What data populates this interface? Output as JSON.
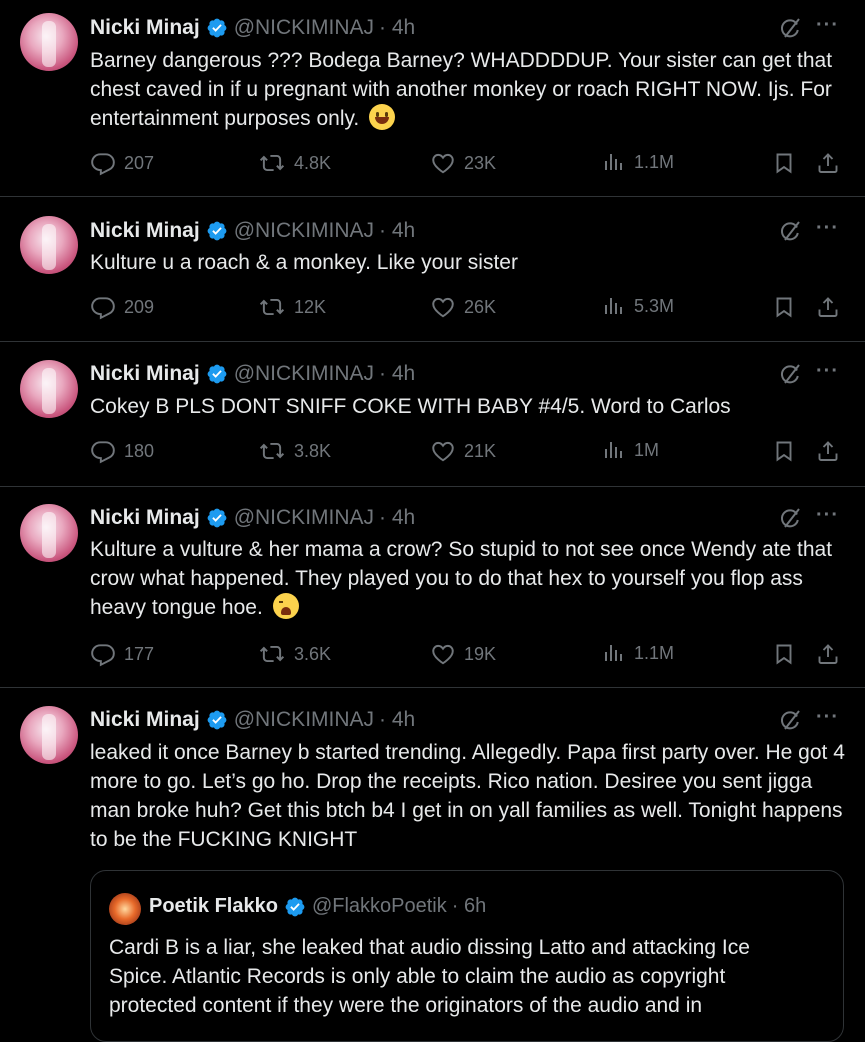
{
  "tweets": [
    {
      "name": "Nicki Minaj",
      "handle": "@NICKIMINAJ",
      "time": "· 4h",
      "text": "Barney dangerous ??? Bodega Barney? WHADDDDUP. Your sister can get that chest caved in if u pregnant with another monkey or roach RIGHT NOW. Ijs. For entertainment purposes only.",
      "emoji": "smile-emoji",
      "replies": "207",
      "reposts": "4.8K",
      "likes": "23K",
      "views": "1.1M"
    },
    {
      "name": "Nicki Minaj",
      "handle": "@NICKIMINAJ",
      "time": "· 4h",
      "text": "Kulture u a roach & a monkey. Like your sister",
      "replies": "209",
      "reposts": "12K",
      "likes": "26K",
      "views": "5.3M"
    },
    {
      "name": "Nicki Minaj",
      "handle": "@NICKIMINAJ",
      "time": "· 4h",
      "text": "Cokey B PLS DONT SNIFF COKE WITH BABY #4/5. Word to Carlos",
      "replies": "180",
      "reposts": "3.8K",
      "likes": "21K",
      "views": "1M"
    },
    {
      "name": "Nicki Minaj",
      "handle": "@NICKIMINAJ",
      "time": "· 4h",
      "text": "Kulture a vulture & her mama a crow? So stupid to not see once Wendy ate that crow what happened. They played you to do that hex to yourself you flop ass heavy tongue hoe.",
      "emoji": "weary-emoji",
      "replies": "177",
      "reposts": "3.6K",
      "likes": "19K",
      "views": "1.1M"
    },
    {
      "name": "Nicki Minaj",
      "handle": "@NICKIMINAJ",
      "time": "· 4h",
      "text": "leaked it once Barney b started trending. Allegedly. Papa first party over. He got 4 more to go. Let’s go ho. Drop the receipts. Rico nation. Desiree you sent jigga man broke huh? Get this btch b4 I get in on yall families as well. Tonight happens to be the FUCKING KNIGHT"
    }
  ],
  "quote": {
    "name": "Poetik Flakko",
    "handle": "@FlakkoPoetik",
    "time": "· 6h",
    "text": "Cardi B is a liar, she leaked that audio dissing Latto and attacking Ice Spice. Atlantic Records is only able to claim the audio as copyright protected content if they were the originators of the audio and in"
  },
  "more_glyph": "···",
  "colors": {
    "background": "#000000",
    "text": "#e7e9ea",
    "muted": "#71767b",
    "verified": "#1d9bf0",
    "divider": "#2f3336"
  }
}
